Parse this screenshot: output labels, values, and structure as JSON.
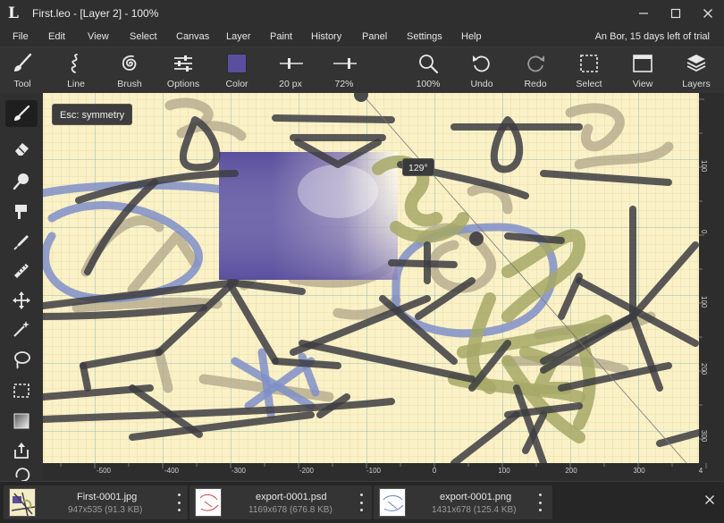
{
  "window": {
    "title": "First.leo - [Layer 2] - 100%",
    "app_icon": "L"
  },
  "menu": {
    "items": [
      "File",
      "Edit",
      "View",
      "Select",
      "Canvas",
      "Layer",
      "Paint",
      "History",
      "Panel",
      "Settings",
      "Help"
    ],
    "trial": "An Bor, 15 days left of trial"
  },
  "toolbar": {
    "items": [
      {
        "label": "Tool",
        "icon": "brush-icon"
      },
      {
        "label": "Line",
        "icon": "line-squiggle-icon"
      },
      {
        "label": "Brush",
        "icon": "spiral-brush-icon"
      },
      {
        "label": "Options",
        "icon": "sliders-icon"
      },
      {
        "label": "Color",
        "icon": "color-swatch"
      },
      {
        "label": "20 px",
        "icon": "size-slider-icon"
      },
      {
        "label": "72%",
        "icon": "opacity-slider-icon"
      },
      {
        "label": "100%",
        "icon": "zoom-icon"
      },
      {
        "label": "Undo",
        "icon": "undo-icon"
      },
      {
        "label": "Redo",
        "icon": "redo-icon"
      },
      {
        "label": "Select",
        "icon": "select-icon"
      },
      {
        "label": "View",
        "icon": "view-icon"
      },
      {
        "label": "Layers",
        "icon": "layers-icon"
      }
    ],
    "color": "#5a4f9e"
  },
  "canvas": {
    "hint": "Esc: symmetry",
    "angle": "129°",
    "ruler_bottom": [
      "-500",
      "-400",
      "-300",
      "-200",
      "-100",
      "0",
      "100",
      "200",
      "300",
      "4"
    ],
    "ruler_right": [
      "100",
      "0",
      "100",
      "200",
      "300"
    ]
  },
  "files": [
    {
      "name": "First-0001.jpg",
      "meta": "947x535 (91.3 KB)"
    },
    {
      "name": "export-0001.psd",
      "meta": "1169x678 (676.8 KB)"
    },
    {
      "name": "export-0001.png",
      "meta": "1431x678 (125.4 KB)"
    }
  ],
  "colors": {
    "canvas_bg": "#faf1c6",
    "stroke_dark": "#3d3d42",
    "stroke_blue": "#7f8fc8",
    "stroke_olive": "#a4a866",
    "stroke_tan": "#b0a58a",
    "rect_purple": "#5a4f9e"
  }
}
